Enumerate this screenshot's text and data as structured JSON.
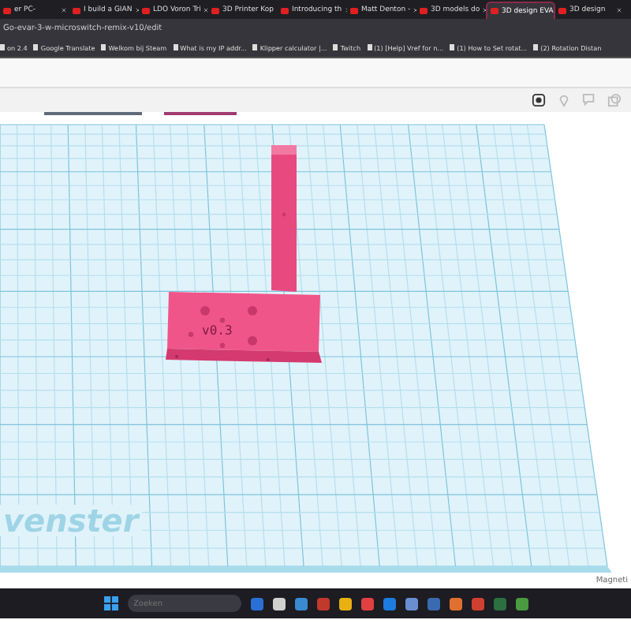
{
  "browser": {
    "tabs": [
      {
        "label": "er PC-",
        "selected": false
      },
      {
        "label": "I build a GIAN",
        "selected": false
      },
      {
        "label": "LDO Voron Tri",
        "selected": false
      },
      {
        "label": "3D Printer Kop",
        "selected": false
      },
      {
        "label": "Introducing th",
        "selected": false
      },
      {
        "label": "Matt Denton -",
        "selected": false
      },
      {
        "label": "3D models do",
        "selected": false
      },
      {
        "label": "3D design EVA",
        "selected": true
      },
      {
        "label": "3D design",
        "selected": false
      }
    ],
    "address": "Go-evar-3-w-microswitch-remix-v10/edit",
    "bookmarks": [
      "on 2.4",
      "Google Translate",
      "Welkom bij Steam",
      "What is my IP addr...",
      "Klipper calculator |...",
      "Twitch",
      "(1) [Help] Vref for n...",
      "(1) How to Set rotat...",
      "(2) Rotation Distan"
    ]
  },
  "editor": {
    "model_label": "v0.3",
    "workplane_label": "venster",
    "status": "Magneti"
  },
  "taskbar": {
    "search_placeholder": "Zoeken"
  }
}
